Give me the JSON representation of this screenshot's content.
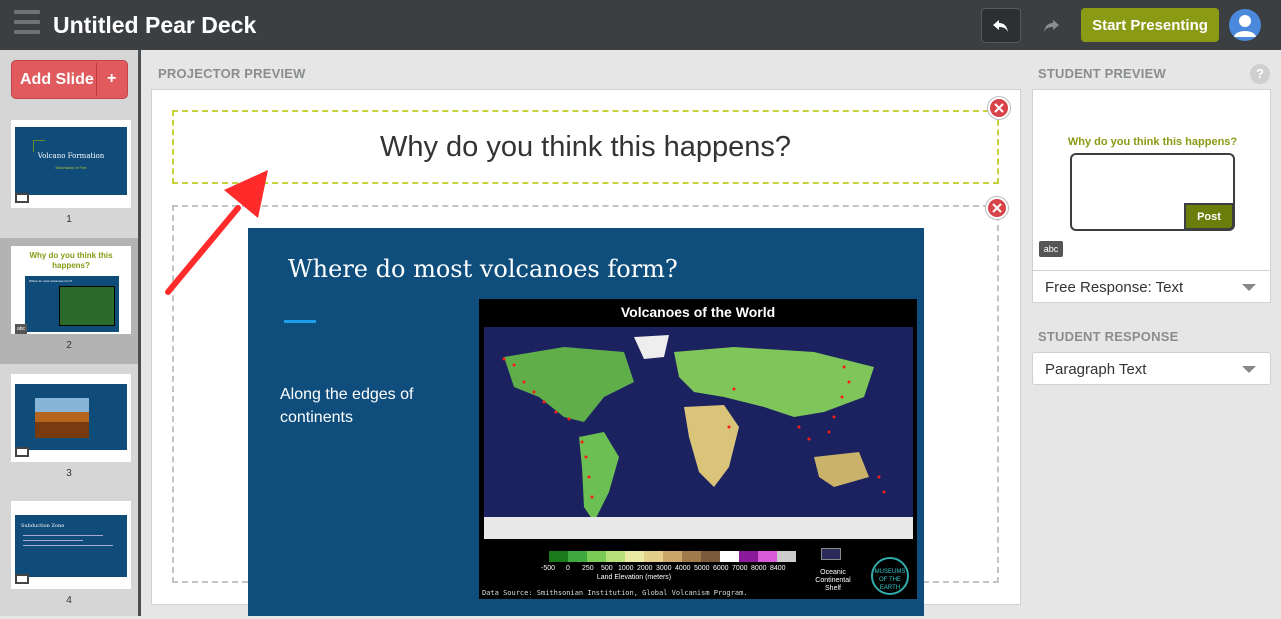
{
  "header": {
    "title": "Untitled Pear Deck",
    "start_label": "Start Presenting"
  },
  "sidebar": {
    "add_slide_label": "Add Slide",
    "add_plus": "+",
    "thumbnails": [
      {
        "number": "1",
        "title": "Volcano Formation",
        "subtitle": "Mountains of Fire"
      },
      {
        "number": "2",
        "title": "Why do you think this happens?",
        "subtitle": "Where do most volcanoes form?"
      },
      {
        "number": "3"
      },
      {
        "number": "4",
        "title": "Subduction Zone"
      }
    ]
  },
  "projector": {
    "section_label": "PROJECTOR PREVIEW",
    "question": "Why do you think this happens?",
    "slide": {
      "title": "Where do most volcanoes form?",
      "bullet": "Along the edges of continents",
      "map_title": "Volcanoes of the World",
      "legend_ticks": [
        "-500",
        "0",
        "250",
        "500",
        "1000",
        "2000",
        "3000",
        "4000",
        "5000",
        "6000",
        "7000",
        "8000",
        "8400"
      ],
      "legend_label": "Land Elevation (meters)",
      "ocean_label": "Oceanic Continental Shelf",
      "data_source": "Data Source: Smithsonian Institution, Global Volcanism Program.",
      "museum_logo": "MUSEUMS OF THE EARTH"
    }
  },
  "student_preview": {
    "section_label": "STUDENT PREVIEW",
    "help": "?",
    "question": "Why do you think this happens?",
    "post_label": "Post",
    "badge": "abc",
    "question_type": "Free Response: Text"
  },
  "student_response": {
    "section_label": "STUDENT RESPONSE",
    "type": "Paragraph Text"
  },
  "colors": {
    "topbar": "#3b3f42",
    "accent_green": "#8a9a14",
    "add_slide_red": "#e05a5e",
    "slide_blue": "#0f4e7c",
    "arrow_red": "#ff2a2a"
  }
}
